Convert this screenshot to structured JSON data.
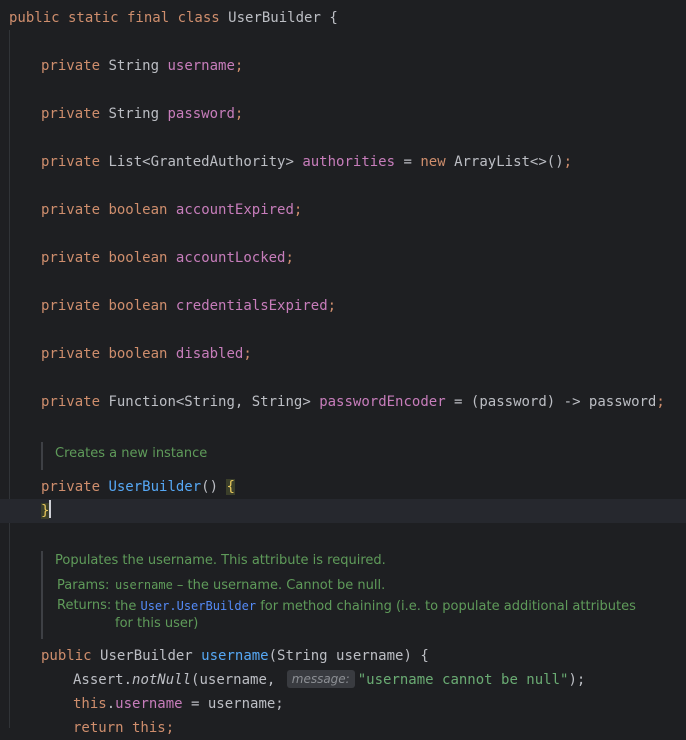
{
  "class_decl": {
    "modifiers": "public static final class",
    "name": "UserBuilder",
    "open": "{"
  },
  "fields": [
    {
      "modifier": "private",
      "type": "String",
      "type_is_keyword": false,
      "name": "username",
      "init": ""
    },
    {
      "modifier": "private",
      "type": "String",
      "type_is_keyword": false,
      "name": "password",
      "init": ""
    },
    {
      "modifier": "private",
      "type": "List<GrantedAuthority>",
      "type_is_keyword": false,
      "name": "authorities",
      "init_op": " = ",
      "init_kw": "new",
      "init": " ArrayList<>()"
    },
    {
      "modifier": "private",
      "type": "boolean",
      "type_is_keyword": true,
      "name": "accountExpired",
      "init": ""
    },
    {
      "modifier": "private",
      "type": "boolean",
      "type_is_keyword": true,
      "name": "accountLocked",
      "init": ""
    },
    {
      "modifier": "private",
      "type": "boolean",
      "type_is_keyword": true,
      "name": "credentialsExpired",
      "init": ""
    },
    {
      "modifier": "private",
      "type": "boolean",
      "type_is_keyword": true,
      "name": "disabled",
      "init": ""
    },
    {
      "modifier": "private",
      "type": "Function<String, String>",
      "type_is_keyword": false,
      "name": "passwordEncoder",
      "init_op": " = ",
      "init": "(password) -> password"
    }
  ],
  "doc_constructor": {
    "text": "Creates a new instance"
  },
  "constructor": {
    "modifier": "private",
    "name": "UserBuilder",
    "parens": "()",
    "open": "{",
    "close": "}"
  },
  "doc_username": {
    "summary": "Populates the username. This attribute is required.",
    "params_label": "Params:",
    "param_name": "username",
    "param_desc": " – the username. Cannot be null.",
    "returns_label": "Returns:",
    "returns_pre": "the ",
    "returns_link": "User.UserBuilder",
    "returns_post": " for method chaining (i.e. to populate additional attributes for this user)"
  },
  "method_username": {
    "modifier": "public",
    "return_type": "UserBuilder",
    "name": "username",
    "params": "(String username) {",
    "assert_class": "Assert.",
    "assert_method": "notNull",
    "assert_args_pre": "(username, ",
    "hint_label": "message:",
    "assert_string": "\"username cannot be null\"",
    "assert_close": ");",
    "this_kw": "this",
    "this_field": "username",
    "this_rest": " = username;",
    "return_kw": "return",
    "return_val": " this;"
  },
  "colors": {
    "background": "#1e1f22",
    "keyword": "#cf8e6d",
    "field": "#c77dbb",
    "string": "#6aab73",
    "doc": "#5f9b5a",
    "link": "#548af7"
  }
}
